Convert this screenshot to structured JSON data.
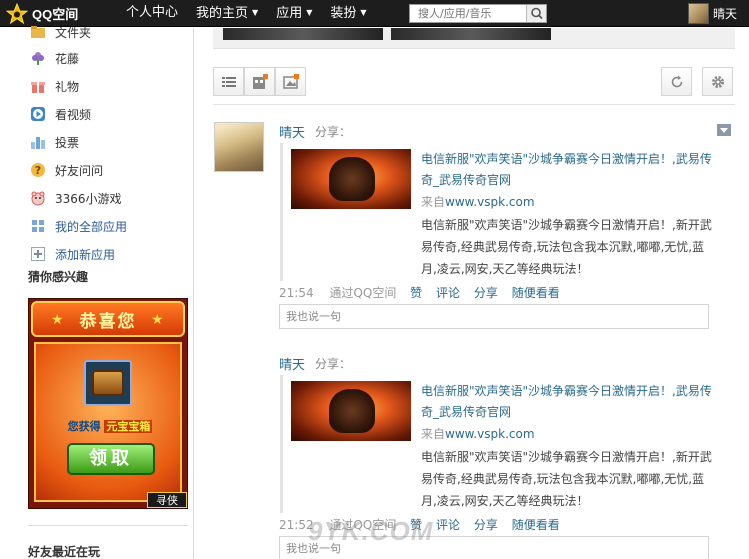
{
  "topbar": {
    "logo_text": "QQ空间",
    "nav": [
      {
        "label": "个人中心",
        "caret": ""
      },
      {
        "label": "我的主页",
        "caret": "▼"
      },
      {
        "label": "应用",
        "caret": "▼"
      },
      {
        "label": "装扮",
        "caret": "▼"
      }
    ],
    "search_placeholder": "搜人/应用/音乐",
    "user_name": "晴天"
  },
  "sidebar": {
    "apps": [
      {
        "label": "文件夹",
        "icon": "folder-icon"
      },
      {
        "label": "花藤",
        "icon": "flower-icon"
      },
      {
        "label": "礼物",
        "icon": "gift-icon"
      },
      {
        "label": "看视频",
        "icon": "video-icon"
      },
      {
        "label": "投票",
        "icon": "vote-icon"
      },
      {
        "label": "好友问问",
        "icon": "question-icon"
      },
      {
        "label": "3366小游戏",
        "icon": "game-icon"
      },
      {
        "label": "我的全部应用",
        "icon": "all-apps-icon"
      },
      {
        "label": "添加新应用",
        "icon": "add-app-icon"
      }
    ],
    "interest_title": "猜你感兴趣",
    "promo": {
      "title": "恭喜您",
      "gain_prefix": "您获得",
      "gain_item": "元宝宝箱",
      "button": "领取",
      "tag": "寻侠"
    },
    "friends_title": "好友最近在玩"
  },
  "feed": [
    {
      "name": "晴天",
      "verb": "分享：",
      "title": "电信新服\"欢声笑语\"沙城争霸赛今日激情开启！,武易传奇_武易传奇官网",
      "source_prefix": "来自",
      "source_link": "www.vspk.com",
      "desc": "电信新服\"欢声笑语\"沙城争霸赛今日激情开启！,新开武易传奇,经典武易传奇,玩法包含我本沉默,嘟嘟,无忧,蓝月,凌云,网安,天乙等经典玩法！",
      "time": "21:54",
      "via": "通过QQ空间",
      "actions": [
        "赞",
        "评论",
        "分享",
        "随便看看"
      ],
      "comment_placeholder": "我也说一句"
    },
    {
      "name": "晴天",
      "verb": "分享：",
      "title": "电信新服\"欢声笑语\"沙城争霸赛今日激情开启！,武易传奇_武易传奇官网",
      "source_prefix": "来自",
      "source_link": "www.vspk.com",
      "desc": "电信新服\"欢声笑语\"沙城争霸赛今日激情开启！,新开武易传奇,经典武易传奇,玩法包含我本沉默,嘟嘟,无忧,蓝月,凌云,网安,天乙等经典玩法！",
      "time": "21:52",
      "via": "通过QQ空间",
      "actions": [
        "赞",
        "评论",
        "分享",
        "随便看看"
      ],
      "comment_placeholder": "我也说一句"
    }
  ],
  "watermark": "9YK.COM"
}
